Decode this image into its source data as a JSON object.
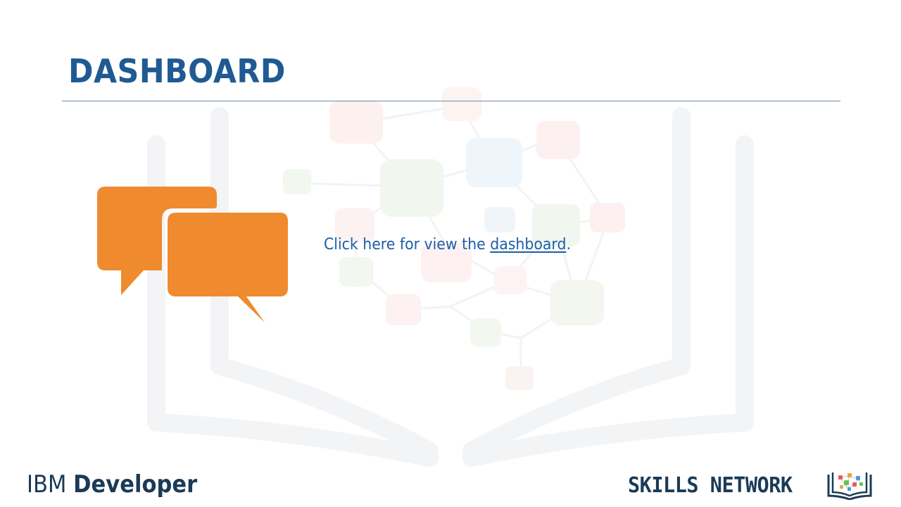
{
  "slide": {
    "title": "DASHBOARD",
    "message": {
      "prefix": "Click here for view the ",
      "link_text": "dashboard",
      "suffix": "."
    }
  },
  "footer": {
    "ibm": {
      "brand": "IBM",
      "product": "Developer"
    },
    "skills_network": {
      "label": "SKILLS NETWORK"
    }
  },
  "colors": {
    "title": "#1f5a93",
    "link": "#1c5fa8",
    "chat_icon": "#ef8a2e",
    "footer_text": "#1b3a57"
  },
  "icons": [
    "chat-bubbles-icon",
    "skills-network-book-icon"
  ]
}
